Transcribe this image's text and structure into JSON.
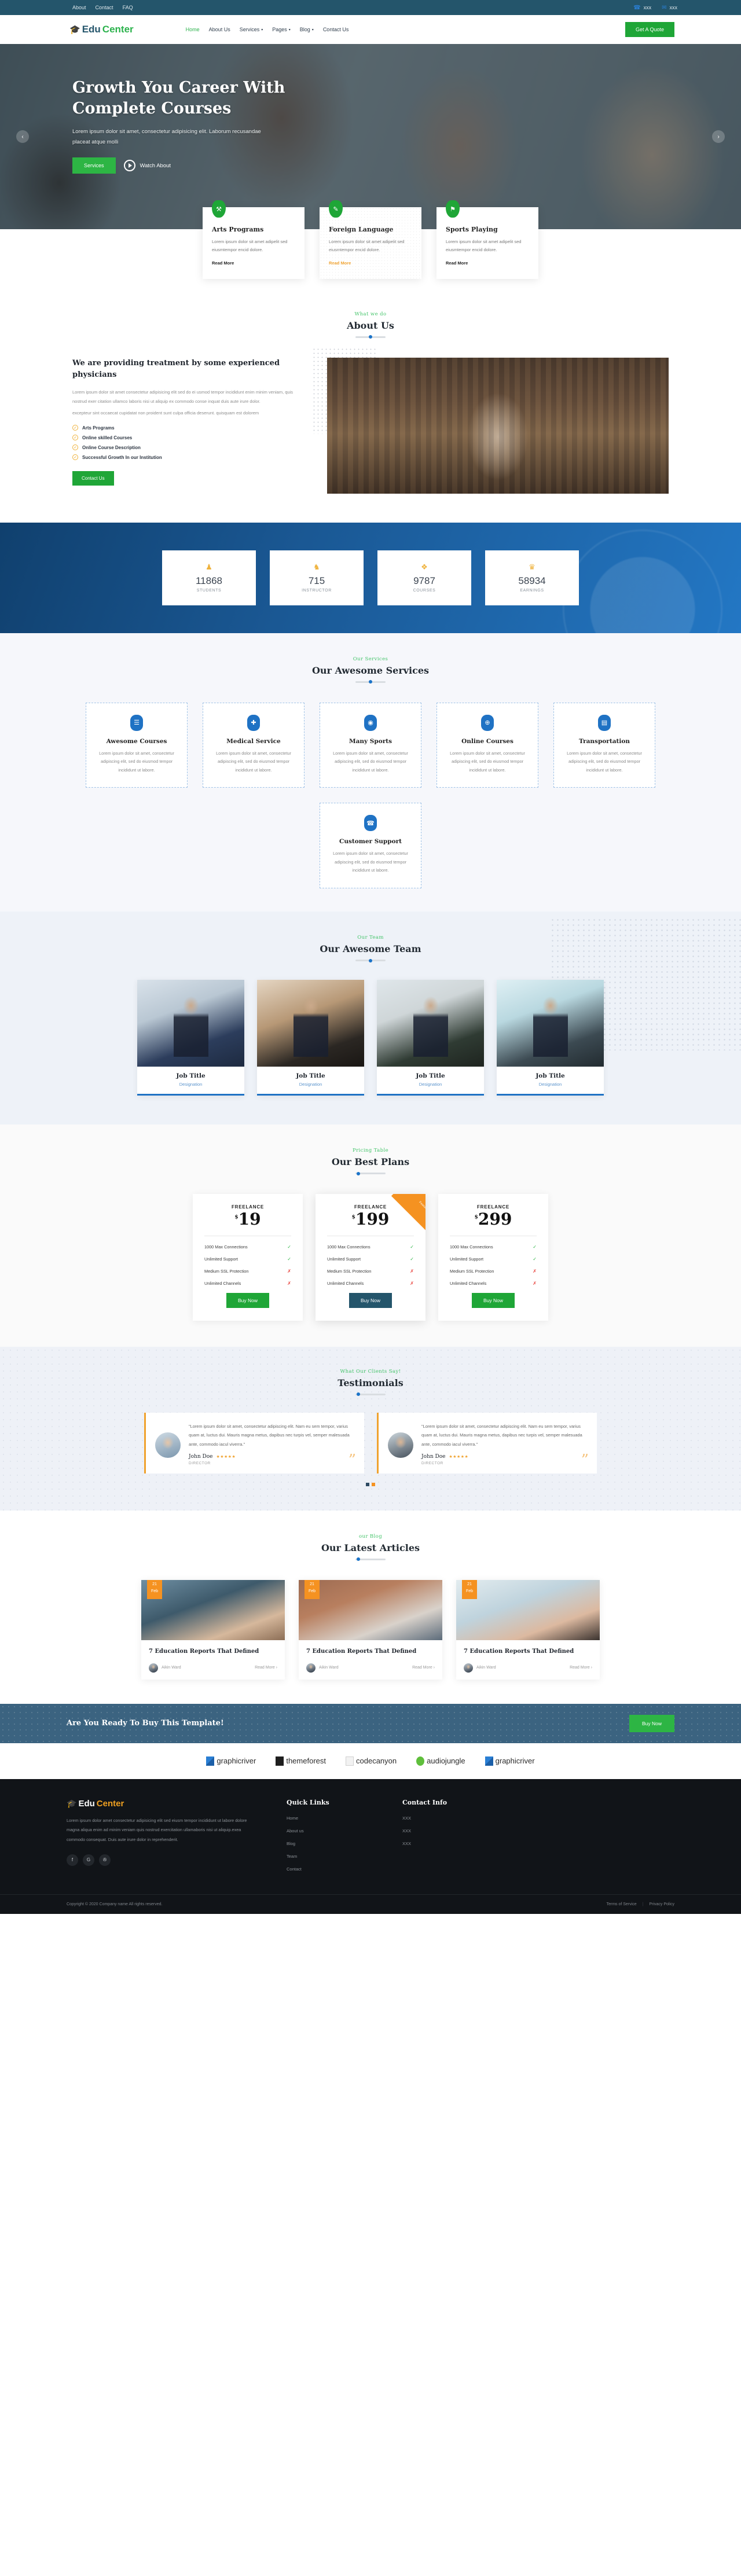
{
  "topbar": {
    "links": [
      "About",
      "Contact",
      "FAQ"
    ],
    "phone": "xxx",
    "email": "xxx",
    "phone_icon": "phone-icon",
    "email_icon": "envelope-icon"
  },
  "header": {
    "logo": {
      "icon": "graduation-cap-icon",
      "part1": "Edu",
      "part2": "Center"
    },
    "nav": [
      {
        "label": "Home",
        "caret": ""
      },
      {
        "label": "About Us",
        "caret": ""
      },
      {
        "label": "Services",
        "caret": "▾"
      },
      {
        "label": "Pages",
        "caret": "▾"
      },
      {
        "label": "Blog",
        "caret": "▾"
      },
      {
        "label": "Contact Us",
        "caret": ""
      }
    ],
    "quote_button": "Get A Quote"
  },
  "hero": {
    "title": "Growth You Career With Complete Courses",
    "text": "Lorem ipsum dolor sit amet, consectetur adipisicing elit. Laborum recusandae placeat atque molli",
    "primary_button": "Services",
    "watch_label": "Watch About",
    "prev_icon": "chevron-left-icon",
    "next_icon": "chevron-right-icon"
  },
  "features": [
    {
      "icon": "palette-icon",
      "glyph": "⚒",
      "title": "Arts Programs",
      "text": "Lorem ipsum dolor sit amet adipelit sed eiusmtempor encid dolore.",
      "link": "Read More",
      "highlight": false
    },
    {
      "icon": "document-icon",
      "glyph": "✎",
      "title": "Foreign Language",
      "text": "Lorem ipsum dolor sit amet adipelit sed eiusmtempor encid dolore.",
      "link": "Read More",
      "highlight": true
    },
    {
      "icon": "medal-icon",
      "glyph": "⚑",
      "title": "Sports Playing",
      "text": "Lorem ipsum dolor sit amet adipelit sed eiusmtempor encid dolore.",
      "link": "Read More",
      "highlight": false
    }
  ],
  "about": {
    "subtitle": "What we do",
    "title": "About Us",
    "heading": "We are providing treatment by some experienced physicians",
    "paragraph1": "Lorem ipsum dolor sit amet consectetur adipisicing elit sed do ei usmod tempor incididunt enim minim veniam, quis nostrud exer citation ullamco laboris nisi ut aliquip ex commodo conse inquat duis aute irure dolor.",
    "paragraph2": "excepteur sint occaecat cupidatat non proident sunt culpa officia deserunt. quisquam est dolorem",
    "checklist": [
      "Arts Programs",
      "Online skilled Courses",
      "Online Course Description",
      "Successful Growth In our Institution"
    ],
    "button": "Contact Us"
  },
  "counters": [
    {
      "icon": "user-icon",
      "glyph": "♟",
      "value": "11868",
      "label": "STUDENTS"
    },
    {
      "icon": "chess-knight-icon",
      "glyph": "♞",
      "value": "715",
      "label": "INSTRUCTOR"
    },
    {
      "icon": "puzzle-icon",
      "glyph": "❖",
      "value": "9787",
      "label": "COURSES"
    },
    {
      "icon": "trophy-icon",
      "glyph": "♛",
      "value": "58934",
      "label": "EARNINGS"
    }
  ],
  "services": {
    "subtitle": "Our Services",
    "title": "Our Awesome Services",
    "items": [
      {
        "icon": "book-icon",
        "glyph": "☰",
        "title": "Awesome Courses",
        "text": "Lorem ipsum dolor sit amet, consectetur adipiscing elit, sed do eiusmod tempor incididunt ut labore."
      },
      {
        "icon": "medical-cross-icon",
        "glyph": "✚",
        "title": "Medical Service",
        "text": "Lorem ipsum dolor sit amet, consectetur adipiscing elit, sed do eiusmod tempor incididunt ut labore."
      },
      {
        "icon": "target-icon",
        "glyph": "◉",
        "title": "Many Sports",
        "text": "Lorem ipsum dolor sit amet, consectetur adipiscing elit, sed do eiusmod tempor incididunt ut labore."
      },
      {
        "icon": "globe-icon",
        "glyph": "⊕",
        "title": "Online Courses",
        "text": "Lorem ipsum dolor sit amet, consectetur adipiscing elit, sed do eiusmod tempor incididunt ut labore."
      },
      {
        "icon": "bus-icon",
        "glyph": "▤",
        "title": "Transportation",
        "text": "Lorem ipsum dolor sit amet, consectetur adipiscing elit, sed do eiusmod tempor incididunt ut labore."
      },
      {
        "icon": "phone-icon",
        "glyph": "☎",
        "title": "Customer Support",
        "text": "Lorem ipsum dolor sit amet, consectetur adipiscing elit, sed do eiusmod tempor incididunt ut labore."
      }
    ]
  },
  "team": {
    "subtitle": "Our Team",
    "title": "Our Awesome Team",
    "members": [
      {
        "name": "Job Title",
        "role": "Designation"
      },
      {
        "name": "Job Title",
        "role": "Designation"
      },
      {
        "name": "Job Title",
        "role": "Designation"
      },
      {
        "name": "Job Title",
        "role": "Designation"
      }
    ]
  },
  "pricing": {
    "subtitle": "Pricing Table",
    "title": "Our Best Plans",
    "ribbon": "Featured",
    "plans": [
      {
        "name": "FREELANCE",
        "currency": "$",
        "price": "19",
        "button": "Buy Now",
        "featured": false,
        "features": [
          {
            "label": "1000 Max Connections",
            "included": true
          },
          {
            "label": "Unlimited Support",
            "included": true
          },
          {
            "label": "Medium SSL Protection",
            "included": false
          },
          {
            "label": "Unlimited Channels",
            "included": false
          }
        ]
      },
      {
        "name": "FREELANCE",
        "currency": "$",
        "price": "199",
        "button": "Buy Now",
        "featured": true,
        "features": [
          {
            "label": "1000 Max Connections",
            "included": true
          },
          {
            "label": "Unlimited Support",
            "included": true
          },
          {
            "label": "Medium SSL Protection",
            "included": false
          },
          {
            "label": "Unlimited Channels",
            "included": false
          }
        ]
      },
      {
        "name": "FREELANCE",
        "currency": "$",
        "price": "299",
        "button": "Buy Now",
        "featured": false,
        "features": [
          {
            "label": "1000 Max Connections",
            "included": true
          },
          {
            "label": "Unlimited Support",
            "included": true
          },
          {
            "label": "Medium SSL Protection",
            "included": false
          },
          {
            "label": "Unlimited Channels",
            "included": false
          }
        ]
      }
    ]
  },
  "testimonials": {
    "subtitle": "What Our Clients Say!",
    "title": "Testimonials",
    "items": [
      {
        "quote": "\"Lorem ipsum dolor sit amet, consectetur adipiscing elit. Nam eu sem tempor, varius quam at, luctus dui. Mauris magna metus, dapibus nec turpis vel, semper malesuada ante, commodo iacul viverra.\"",
        "name": "John Doe",
        "stars": "★★★★★",
        "role": "DIRECTOR"
      },
      {
        "quote": "\"Lorem ipsum dolor sit amet, consectetur adipiscing elit. Nam eu sem tempor, varius quam at, luctus dui. Mauris magna metus, dapibus nec turpis vel, semper malesuada ante, commodo iacul viverra.\"",
        "name": "John Doe",
        "stars": "★★★★★",
        "role": "DIRECTOR"
      }
    ]
  },
  "blog": {
    "subtitle": "our Blog",
    "title": "Our Latest Articles",
    "posts": [
      {
        "day": "21",
        "month": "Feb",
        "title": "7 Education Reports That Defined",
        "author": "Aikin Ward",
        "link": "Read More ›"
      },
      {
        "day": "21",
        "month": "Feb",
        "title": "7 Education Reports That Defined",
        "author": "Aikin Ward",
        "link": "Read More ›"
      },
      {
        "day": "21",
        "month": "Feb",
        "title": "7 Education Reports That Defined",
        "author": "Aikin Ward",
        "link": "Read More ›"
      }
    ]
  },
  "cta": {
    "heading": "Are You Ready To Buy This Template!",
    "button": "Buy Now"
  },
  "sponsors": [
    {
      "name": "graphicriver",
      "mark": "graphicriver-logo"
    },
    {
      "name": "themeforest",
      "mark": "themeforest-logo"
    },
    {
      "name": "codecanyon",
      "mark": "codecanyon-logo"
    },
    {
      "name": "audiojungle",
      "mark": "audiojungle-logo"
    },
    {
      "name": "graphicriver",
      "mark": "graphicriver-logo"
    }
  ],
  "footer": {
    "logo": {
      "icon": "graduation-cap-icon",
      "part1": "Edu",
      "part2": "Center"
    },
    "about_text": "Lorem ipsum dolor amet consectetur adipisicing elit sed eiusm tempor incididunt ut labore dolore magna aliqua enim ad minim veniam quis nostrud exercitation ullamaboris nisi ut aliquip.exea commodo consequat. Duis aute irure dolor in reprehenderit.",
    "social": [
      {
        "icon": "facebook-icon",
        "glyph": "f"
      },
      {
        "icon": "google-icon",
        "glyph": "G"
      },
      {
        "icon": "twitter-icon",
        "glyph": "✇"
      }
    ],
    "quick_links_title": "Quick Links",
    "quick_links": [
      "Home",
      "About us",
      "Blog",
      "Team",
      "Contact"
    ],
    "contact_title": "Contact Info",
    "contact_items": [
      "XXX",
      "XXX",
      "XXX"
    ],
    "copyright": "Copyright © 2020 Company name All rights reserved.",
    "terms": "Terms of Service",
    "privacy": "Privacy Policy"
  },
  "colors": {
    "green": "#1fa637",
    "blue": "#1f72c4",
    "dark_blue": "#24556b",
    "orange": "#f59221",
    "dark": "#111418"
  }
}
